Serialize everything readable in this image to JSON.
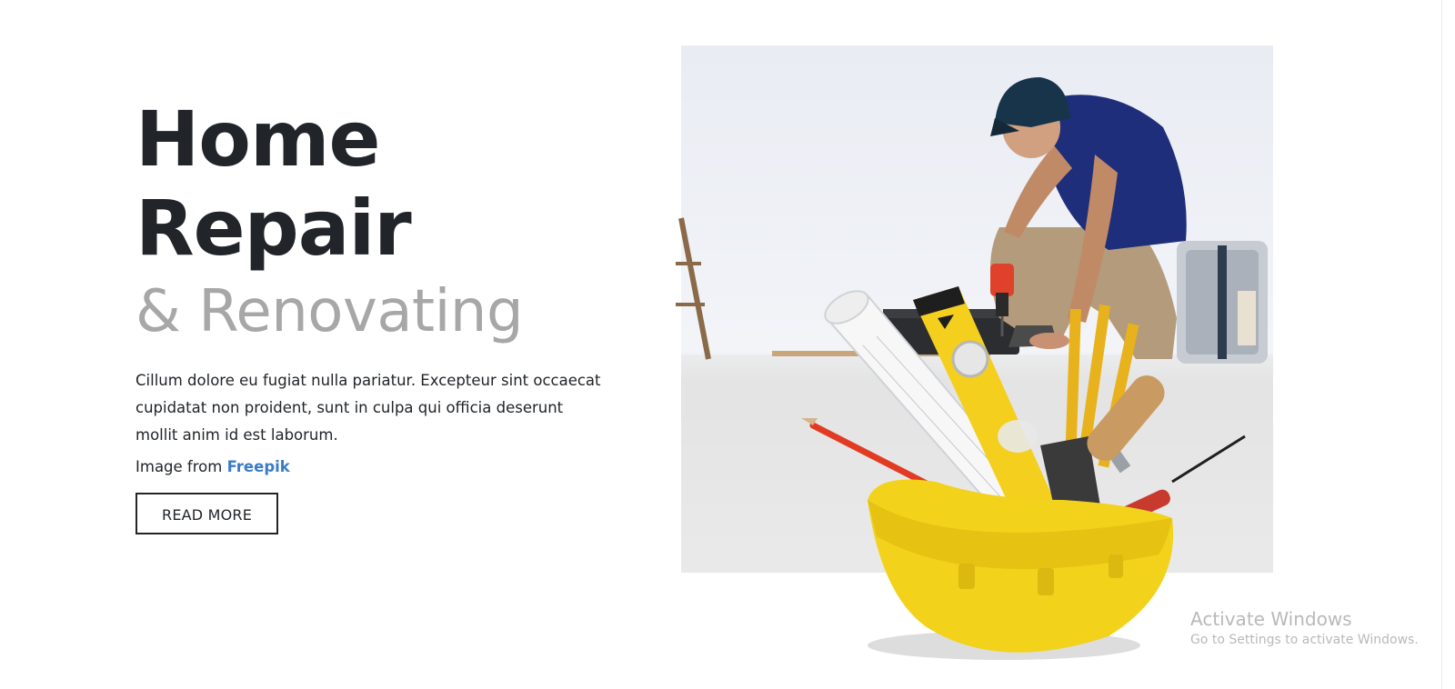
{
  "hero": {
    "title_line1": "Home",
    "title_line2": "Repair",
    "subtitle": "& Renovating",
    "description": "Cillum dolore eu fugiat nulla pariatur. Excepteur sint occaecat cupidatat non proident, sunt in culpa qui officia deserunt mollit anim id est laborum.",
    "credit_prefix": "Image from ",
    "credit_link": "Freepik",
    "cta_label": "READ MORE"
  },
  "image": {
    "subject": "handyman drilling floor with yellow hard hat full of tools"
  },
  "watermark": {
    "title": "Activate Windows",
    "subtitle": "Go to Settings to activate Windows."
  },
  "colors": {
    "text": "#212529",
    "muted": "#a7a7a7",
    "link": "#3a7bc8",
    "helmet": "#f2d21b"
  }
}
